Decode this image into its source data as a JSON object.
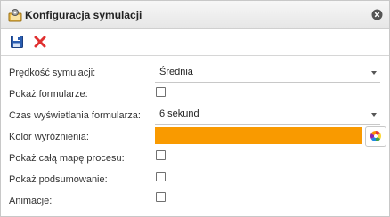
{
  "dialog": {
    "title": "Konfiguracja symulacji",
    "title_icon": "simulation-config-icon",
    "close_icon": "close-circle-icon"
  },
  "toolbar": {
    "save_icon": "floppy-disk-icon",
    "cancel_icon": "red-x-icon"
  },
  "form": {
    "speed": {
      "label": "Prędkość symulacji:",
      "value": "Średnia"
    },
    "show_forms": {
      "label": "Pokaż formularze:",
      "checked": false
    },
    "form_display_time": {
      "label": "Czas wyświetlania formularza:",
      "value": "6 sekund"
    },
    "highlight_color": {
      "label": "Kolor wyróżnienia:",
      "value": "#f99a00",
      "picker_icon": "color-wheel-icon"
    },
    "show_process_map": {
      "label": "Pokaż całą mapę procesu:",
      "checked": false
    },
    "show_summary": {
      "label": "Pokaż podsumowanie:",
      "checked": false
    },
    "animations": {
      "label": "Animacje:",
      "checked": false
    }
  },
  "colors": {
    "highlight": "#f99a00",
    "titlebar": "#eeeeee",
    "cancel": "#e03030",
    "save": "#2a5db0"
  }
}
